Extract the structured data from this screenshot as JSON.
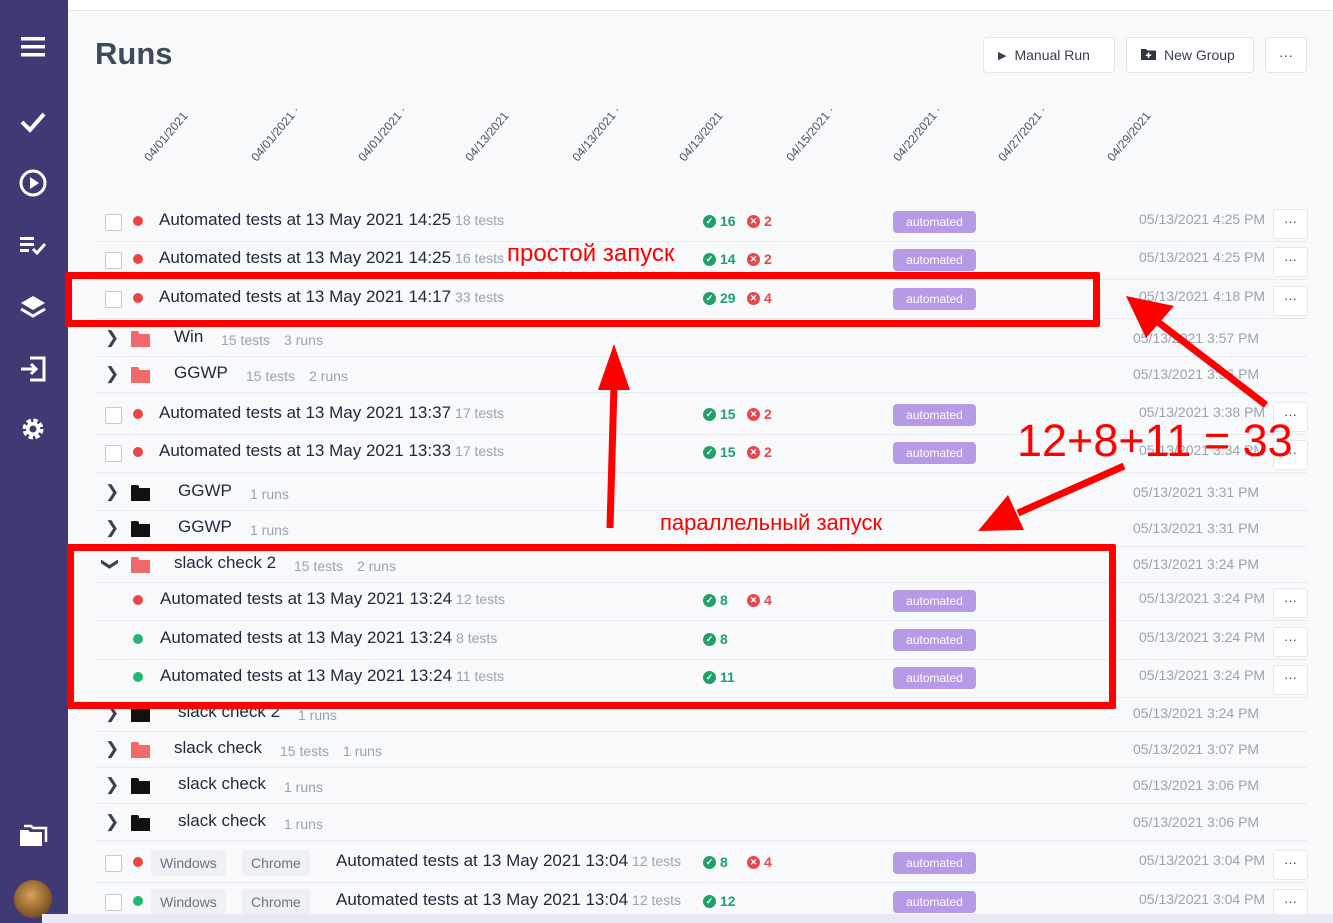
{
  "page": {
    "title": "Runs",
    "manual_run_label": "Manual Run",
    "new_group_label": "New Group",
    "more_label": "···"
  },
  "sidebar": {
    "icons": [
      "menu-icon",
      "checkmark-icon",
      "play-circle-icon",
      "checklist-icon",
      "layers-icon",
      "import-icon",
      "gear-icon",
      "folders-icon"
    ]
  },
  "timeline_dates": [
    "04/01/2021",
    "04/01/2021 ·",
    "04/01/2021 ·",
    "04/13/2021",
    "04/13/2021 ·",
    "04/13/2021",
    "04/15/2021 ·",
    "04/22/2021 ·",
    "04/27/2021 ·",
    "04/29/2021"
  ],
  "rows": [
    {
      "kind": "run",
      "status": "red",
      "title": "Automated tests at 13 May 2021 14:25",
      "tests": "18 tests",
      "passed": "16",
      "failed": "2",
      "tag": "automated",
      "date": "05/13/2021 4:25 PM"
    },
    {
      "kind": "run",
      "status": "red",
      "title": "Automated tests at 13 May 2021 14:25",
      "tests": "16 tests",
      "passed": "14",
      "failed": "2",
      "tag": "automated",
      "date": "05/13/2021 4:25 PM"
    },
    {
      "kind": "run",
      "status": "red",
      "title": "Automated tests at 13 May 2021 14:17",
      "tests": "33 tests",
      "passed": "29",
      "failed": "4",
      "tag": "automated",
      "date": "05/13/2021 4:18 PM"
    },
    {
      "kind": "group",
      "folder": "red",
      "name": "Win",
      "tests": "15 tests",
      "runs": "3 runs",
      "date": "05/13/2021 3:57 PM"
    },
    {
      "kind": "group",
      "folder": "red",
      "name": "GGWP",
      "tests": "15 tests",
      "runs": "2 runs",
      "date": "05/13/2021 3:56 PM"
    },
    {
      "kind": "run",
      "status": "red",
      "title": "Automated tests at 13 May 2021 13:37",
      "tests": "17 tests",
      "passed": "15",
      "failed": "2",
      "tag": "automated",
      "date": "05/13/2021 3:38 PM"
    },
    {
      "kind": "run",
      "status": "red",
      "title": "Automated tests at 13 May 2021 13:33",
      "tests": "17 tests",
      "passed": "15",
      "failed": "2",
      "tag": "automated",
      "date": "05/13/2021 3:34 PM"
    },
    {
      "kind": "group",
      "folder": "black",
      "name": "GGWP",
      "tests": "",
      "runs": "1 runs",
      "date": "05/13/2021 3:31 PM"
    },
    {
      "kind": "group",
      "folder": "black",
      "name": "GGWP",
      "tests": "",
      "runs": "1 runs",
      "date": "05/13/2021 3:31 PM"
    },
    {
      "kind": "group",
      "folder": "red",
      "name": "slack check 2",
      "tests": "15 tests",
      "runs": "2 runs",
      "date": "05/13/2021 3:24 PM",
      "expanded": true
    },
    {
      "kind": "subrun",
      "status": "red",
      "title": "Automated tests at 13 May 2021 13:24",
      "tests": "12 tests",
      "passed": "8",
      "failed": "4",
      "tag": "automated",
      "date": "05/13/2021 3:24 PM"
    },
    {
      "kind": "subrun",
      "status": "green",
      "title": "Automated tests at 13 May 2021 13:24",
      "tests": "8 tests",
      "passed": "8",
      "failed": "",
      "tag": "automated",
      "date": "05/13/2021 3:24 PM"
    },
    {
      "kind": "subrun",
      "status": "green",
      "title": "Automated tests at 13 May 2021 13:24",
      "tests": "11 tests",
      "passed": "11",
      "failed": "",
      "tag": "automated",
      "date": "05/13/2021 3:24 PM"
    },
    {
      "kind": "group",
      "folder": "black",
      "name": "slack check 2",
      "tests": "",
      "runs": "1 runs",
      "date": "05/13/2021 3:24 PM"
    },
    {
      "kind": "group",
      "folder": "red",
      "name": "slack check",
      "tests": "15 tests",
      "runs": "1 runs",
      "date": "05/13/2021 3:07 PM"
    },
    {
      "kind": "group",
      "folder": "black",
      "name": "slack check",
      "tests": "",
      "runs": "1 runs",
      "date": "05/13/2021 3:06 PM"
    },
    {
      "kind": "group",
      "folder": "black",
      "name": "slack check",
      "tests": "",
      "runs": "1 runs",
      "date": "05/13/2021 3:06 PM"
    },
    {
      "kind": "envrun",
      "status": "red",
      "chips": [
        "Windows",
        "Chrome"
      ],
      "title": "Automated tests at 13 May 2021 13:04",
      "tests": "12 tests",
      "passed": "8",
      "failed": "4",
      "tag": "automated",
      "date": "05/13/2021 3:04 PM"
    },
    {
      "kind": "envrun",
      "status": "green",
      "chips": [
        "Windows",
        "Chrome"
      ],
      "title": "Automated tests at 13 May 2021 13:04",
      "tests": "12 tests",
      "passed": "12",
      "failed": "",
      "tag": "automated",
      "date": "05/13/2021 3:04 PM"
    }
  ],
  "annotations": {
    "simple_run": "простой запуск",
    "parallel_run": "параллельный запуск",
    "sum": "12+8+11 = 33",
    "color": "#ff0000"
  },
  "colors": {
    "sidebar": "#3f3a74",
    "tag": "#b69ae6",
    "pass": "#22a06b",
    "fail": "#e5484d"
  }
}
